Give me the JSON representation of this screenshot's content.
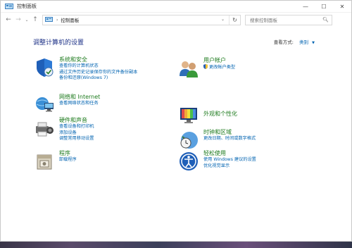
{
  "window": {
    "title": "控制面板",
    "controls": {
      "minimize": "—",
      "maximize": "☐",
      "close": "✕"
    }
  },
  "nav": {
    "back": "←",
    "forward": "→",
    "dropdown": "⌄",
    "up": "↑",
    "breadcrumb_sep": "›",
    "address": "控制面板",
    "refresh": "↻",
    "search_placeholder": "搜索控制面板"
  },
  "main": {
    "heading": "调整计算机的设置",
    "view_by_label": "查看方式:",
    "view_by_value": "类别",
    "categories_left": [
      {
        "icon": "shield-icon",
        "title": "系统和安全",
        "links": [
          "查看你的计算机状态",
          "通过文件历史记录保存你的文件备份副本",
          "备份和还原(Windows 7)"
        ]
      },
      {
        "icon": "network-icon",
        "title": "网络和 Internet",
        "links": [
          "查看网络状态和任务"
        ]
      },
      {
        "icon": "hardware-sound-icon",
        "title": "硬件和声音",
        "links": [
          "查看设备和打印机",
          "添加设备",
          "调整常用移动设置"
        ]
      },
      {
        "icon": "programs-icon",
        "title": "程序",
        "links": [
          "卸载程序"
        ]
      }
    ],
    "categories_right": [
      {
        "icon": "user-accounts-icon",
        "title": "用户帐户",
        "links": [
          "更改帐户类型"
        ]
      },
      {
        "icon": "appearance-icon",
        "title": "外观和个性化",
        "links": []
      },
      {
        "icon": "clock-region-icon",
        "title": "时钟和区域",
        "links": [
          "更改日期、时间或数字格式"
        ]
      },
      {
        "icon": "ease-of-access-icon",
        "title": "轻松使用",
        "links": [
          "使用 Windows 建议的设置",
          "优化视觉显示"
        ]
      }
    ]
  },
  "colors": {
    "heading": "#1e3287",
    "category_title": "#1e7b1e",
    "link": "#0063b1"
  }
}
